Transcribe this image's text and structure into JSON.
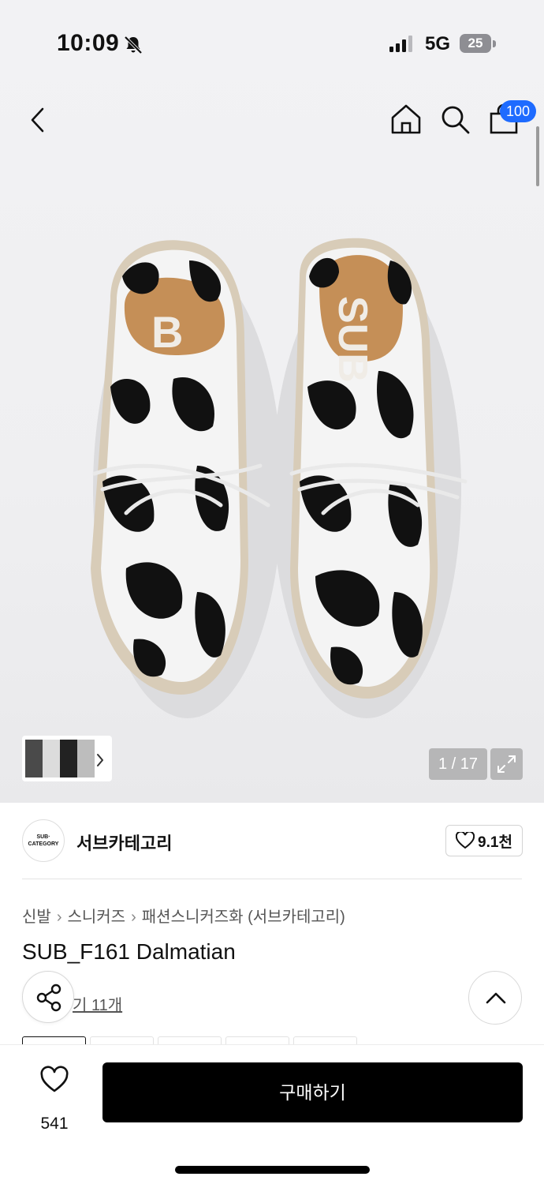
{
  "status_bar": {
    "time": "10:09",
    "network": "5G",
    "battery": "25"
  },
  "nav": {
    "back_icon": "chevron-left-icon",
    "home_icon": "home-icon",
    "search_icon": "search-icon",
    "cart_icon": "shopping-bag-icon",
    "cart_count": "100",
    "badge_color": "#1e6bff"
  },
  "gallery": {
    "counter": "1 / 17",
    "expand_icon": "expand-icon"
  },
  "brand": {
    "logo_text_line1": "SUB·",
    "logo_text_line2": "CATEGORY",
    "name": "서브카테고리",
    "favorite_count": "9.1천"
  },
  "product": {
    "breadcrumb": [
      "신발",
      "스니커즈",
      "패션스니커즈화 (서브카테고리)"
    ],
    "title": "SUB_F161 Dalmatian",
    "review_link": "기 11개"
  },
  "bottom_bar": {
    "like_count": "541",
    "buy_label": "구매하기"
  }
}
